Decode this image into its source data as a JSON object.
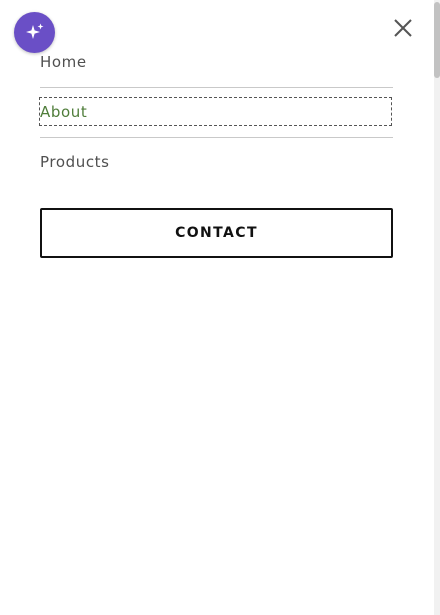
{
  "menu": {
    "items": [
      {
        "label": "Home"
      },
      {
        "label": "About"
      },
      {
        "label": "Products"
      }
    ],
    "cta_label": "CONTACT"
  },
  "icons": {
    "assistant": "sparkles-icon",
    "close": "close-icon"
  },
  "colors": {
    "accent": "#6a4fc6",
    "active_item": "#4f7d3a",
    "text": "#505050",
    "divider": "#c9c9c9",
    "button_border": "#111111"
  }
}
